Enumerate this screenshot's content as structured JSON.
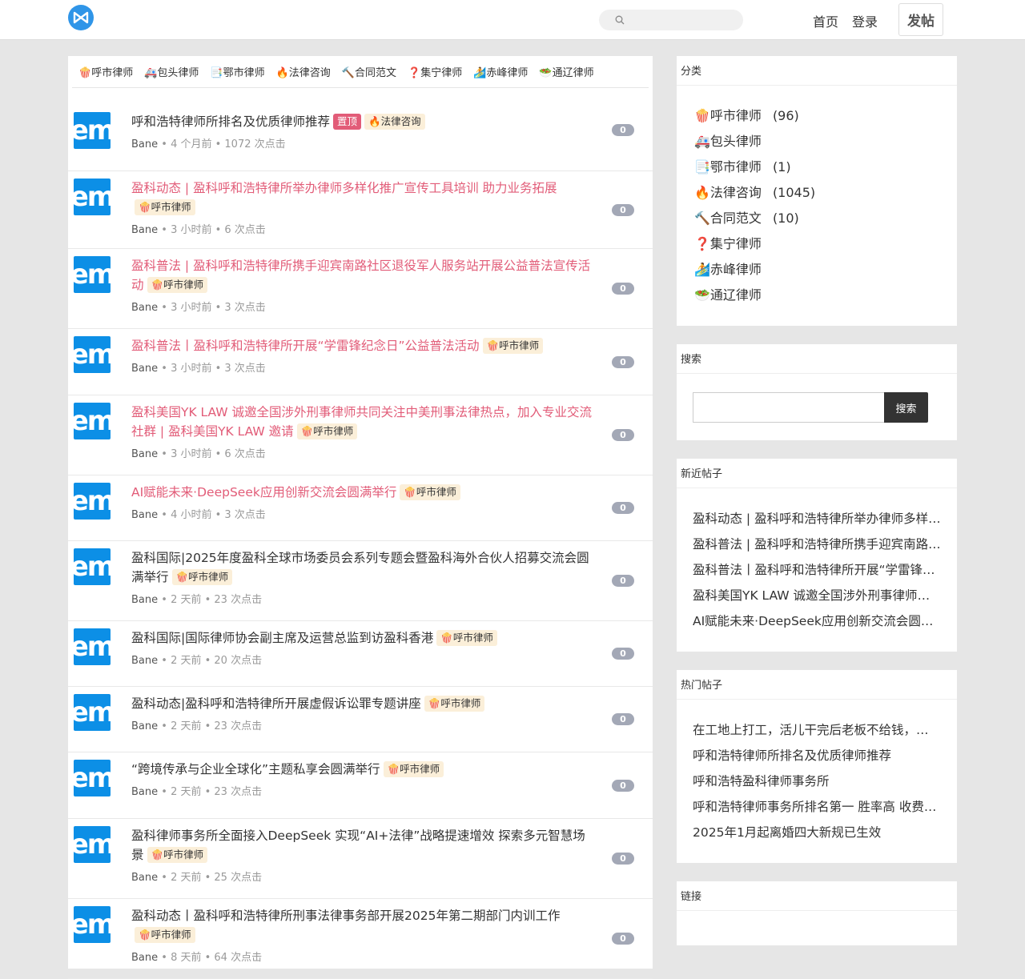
{
  "header": {
    "search_placeholder": "",
    "nav_home": "首页",
    "nav_login": "登录",
    "post_button": "发帖"
  },
  "categories_bar": [
    {
      "icon": "🍿",
      "label": "呼市律师"
    },
    {
      "icon": "🚑",
      "label": "包头律师"
    },
    {
      "icon": "📑",
      "label": "鄂市律师"
    },
    {
      "icon": "🔥",
      "label": "法律咨询"
    },
    {
      "icon": "🔨",
      "label": "合同范文"
    },
    {
      "icon": "❓",
      "label": "集宁律师"
    },
    {
      "icon": "🏄",
      "label": "赤峰律师"
    },
    {
      "icon": "🥗",
      "label": "通辽律师"
    }
  ],
  "posts": [
    {
      "title": "呼和浩特律师所排名及优质律师推荐",
      "red": false,
      "top_label": "置顶",
      "tag_icon": "🔥",
      "tag": "法律咨询",
      "author": "Bane",
      "time": "4 个月前",
      "clicks": "1072 次点击",
      "count": "0"
    },
    {
      "title": "盈科动态 | 盈科呼和浩特律所举办律师多样化推广宣传工具培训 助力业务拓展",
      "red": true,
      "tag_icon": "🍿",
      "tag": "呼市律师",
      "author": "Bane",
      "time": "3 小时前",
      "clicks": "6 次点击",
      "count": "0"
    },
    {
      "title": "盈科普法 | 盈科呼和浩特律所携手迎宾南路社区退役军人服务站开展公益普法宣传活动",
      "red": true,
      "tag_icon": "🍿",
      "tag": "呼市律师",
      "author": "Bane",
      "time": "3 小时前",
      "clicks": "3 次点击",
      "count": "0"
    },
    {
      "title": "盈科普法丨盈科呼和浩特律所开展“学雷锋纪念日”公益普法活动",
      "red": true,
      "tag_icon": "🍿",
      "tag": "呼市律师",
      "author": "Bane",
      "time": "3 小时前",
      "clicks": "3 次点击",
      "count": "0"
    },
    {
      "title": "盈科美国YK LAW 诚邀全国涉外刑事律师共同关注中美刑事法律热点，加入专业交流社群 | 盈科美国YK LAW 邀请",
      "red": true,
      "tag_icon": "🍿",
      "tag": "呼市律师",
      "author": "Bane",
      "time": "3 小时前",
      "clicks": "6 次点击",
      "count": "0"
    },
    {
      "title": "AI赋能未来·DeepSeek应用创新交流会圆满举行",
      "red": true,
      "tag_icon": "🍿",
      "tag": "呼市律师",
      "author": "Bane",
      "time": "4 小时前",
      "clicks": "3 次点击",
      "count": "0"
    },
    {
      "title": "盈科国际|2025年度盈科全球市场委员会系列专题会暨盈科海外合伙人招募交流会圆满举行",
      "red": false,
      "tag_icon": "🍿",
      "tag": "呼市律师",
      "author": "Bane",
      "time": "2 天前",
      "clicks": "23 次点击",
      "count": "0"
    },
    {
      "title": "盈科国际|国际律师协会副主席及运营总监到访盈科香港",
      "red": false,
      "tag_icon": "🍿",
      "tag": "呼市律师",
      "author": "Bane",
      "time": "2 天前",
      "clicks": "20 次点击",
      "count": "0"
    },
    {
      "title": "盈科动态|盈科呼和浩特律所开展虚假诉讼罪专题讲座",
      "red": false,
      "tag_icon": "🍿",
      "tag": "呼市律师",
      "author": "Bane",
      "time": "2 天前",
      "clicks": "23 次点击",
      "count": "0"
    },
    {
      "title": "“跨境传承与企业全球化”主题私享会圆满举行",
      "red": false,
      "tag_icon": "🍿",
      "tag": "呼市律师",
      "author": "Bane",
      "time": "2 天前",
      "clicks": "23 次点击",
      "count": "0"
    },
    {
      "title": "盈科律师事务所全面接入DeepSeek 实现“AI+法律”战略提速增效 探索多元智慧场景",
      "red": false,
      "tag_icon": "🍿",
      "tag": "呼市律师",
      "author": "Bane",
      "time": "2 天前",
      "clicks": "25 次点击",
      "count": "0"
    },
    {
      "title": "盈科动态丨盈科呼和浩特律所刑事法律事务部开展2025年第二期部门内训工作",
      "red": false,
      "tag_icon": "🍿",
      "tag": "呼市律师",
      "author": "Bane",
      "time": "8 天前",
      "clicks": "64 次点击",
      "count": "0"
    }
  ],
  "avatar_text": "em",
  "sidebar": {
    "category_title": "分类",
    "categories": [
      {
        "icon": "🍿",
        "label": "呼市律师",
        "count": "(96)"
      },
      {
        "icon": "🚑",
        "label": "包头律师",
        "count": ""
      },
      {
        "icon": "📑",
        "label": "鄂市律师",
        "count": "(1)"
      },
      {
        "icon": "🔥",
        "label": "法律咨询",
        "count": "(1045)"
      },
      {
        "icon": "🔨",
        "label": "合同范文",
        "count": "(10)"
      },
      {
        "icon": "❓",
        "label": "集宁律师",
        "count": ""
      },
      {
        "icon": "🏄",
        "label": "赤峰律师",
        "count": ""
      },
      {
        "icon": "🥗",
        "label": "通辽律师",
        "count": ""
      }
    ],
    "search_title": "搜索",
    "search_button": "搜索",
    "recent_title": "新近帖子",
    "recent": [
      "盈科动态 | 盈科呼和浩特律所举办律师多样化推广宣传工具培训 助力业务拓展",
      "盈科普法 | 盈科呼和浩特律所携手迎宾南路社区退役军人服务站开展公益普法宣传活动",
      "盈科普法丨盈科呼和浩特律所开展“学雷锋纪念日”公益普法活动",
      "盈科美国YK LAW 诚邀全国涉外刑事律师共同关注中美刑事法律热点",
      "AI赋能未来·DeepSeek应用创新交流会圆满举行"
    ],
    "hot_title": "热门帖子",
    "hot": [
      "在工地上打工，活儿干完后老板不给钱，怎么办",
      "呼和浩特律师所排名及优质律师推荐",
      "呼和浩特盈科律师事务所",
      "呼和浩特律师事务所排名第一 胜率高 收费合理",
      "2025年1月起离婚四大新规已生效"
    ],
    "links_title": "链接"
  }
}
